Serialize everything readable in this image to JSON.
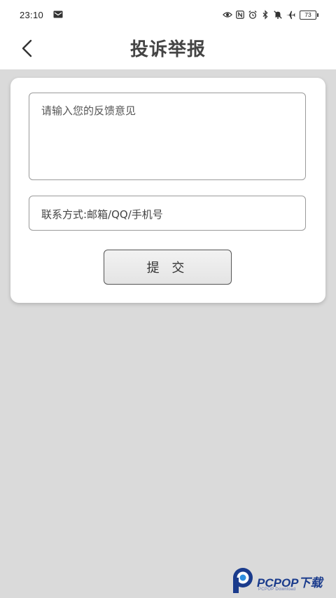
{
  "status_bar": {
    "time": "23:10",
    "battery": "73",
    "icons": [
      "mail-icon",
      "eye-icon",
      "nfc-icon",
      "alarm-icon",
      "bluetooth-icon",
      "mute-icon",
      "airplane-icon",
      "battery-icon"
    ]
  },
  "header": {
    "title": "投诉举报",
    "back_icon": "chevron-left-icon"
  },
  "form": {
    "feedback_placeholder": "请输入您的反馈意见",
    "feedback_value": "",
    "contact_placeholder": "联系方式:邮箱/QQ/手机号",
    "contact_value": "",
    "submit_label": "提 交"
  },
  "watermark": {
    "brand": "PCPOP下载",
    "sub": "PCPOP Download"
  },
  "colors": {
    "background": "#dadada",
    "card": "#ffffff",
    "watermark": "#1a3b8c"
  }
}
